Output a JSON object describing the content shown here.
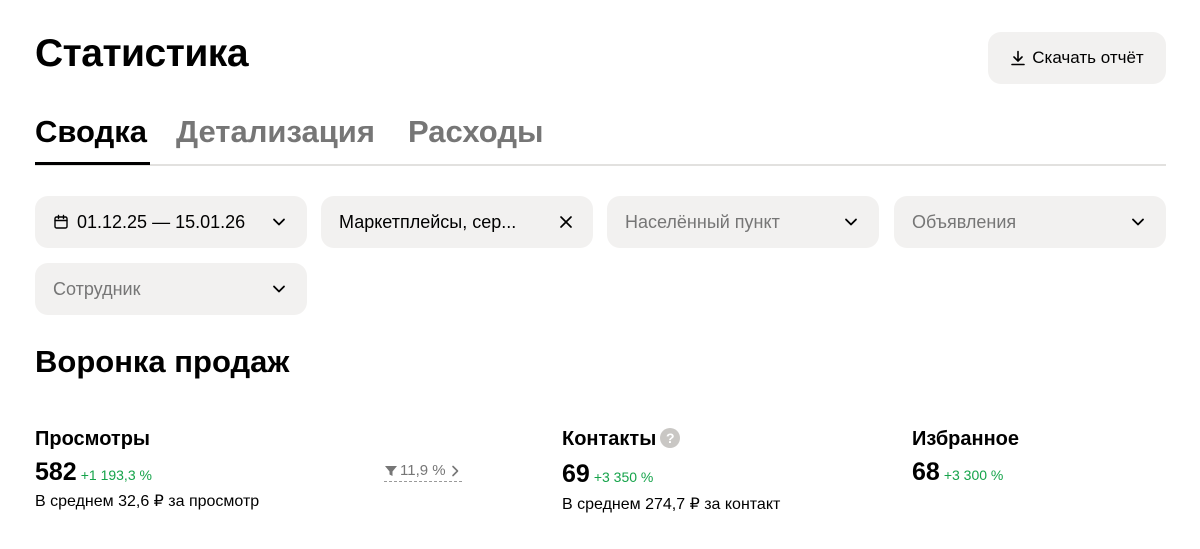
{
  "header": {
    "title": "Статистика",
    "download_label": "Скачать отчёт"
  },
  "tabs": [
    {
      "label": "Сводка",
      "active": true
    },
    {
      "label": "Детализация",
      "active": false
    },
    {
      "label": "Расходы",
      "active": false
    }
  ],
  "filters": {
    "date_range": "01.12.25 — 15.01.26",
    "channels": "Маркетплейсы, сер...",
    "city_placeholder": "Населённый пункт",
    "ads_placeholder": "Объявления",
    "employee_placeholder": "Сотрудник"
  },
  "funnel": {
    "title": "Воронка продаж",
    "views": {
      "name": "Просмотры",
      "value": "582",
      "delta": "+1 193,3 %",
      "note": "В среднем 32,6 ₽ за просмотр"
    },
    "conversion": "11,9 %",
    "contacts": {
      "name": "Контакты",
      "value": "69",
      "delta": "+3 350 %",
      "note": "В среднем 274,7 ₽ за контакт",
      "help": "?"
    },
    "favorites": {
      "name": "Избранное",
      "value": "68",
      "delta": "+3 300 %"
    }
  },
  "colors": {
    "accent_positive": "#15a34a",
    "muted_text": "#767676",
    "surface": "#f2f1f0"
  },
  "icons": [
    "download-icon",
    "calendar-icon",
    "chevron-down-icon",
    "close-icon",
    "filter-icon",
    "chevron-right-icon",
    "help-icon"
  ]
}
